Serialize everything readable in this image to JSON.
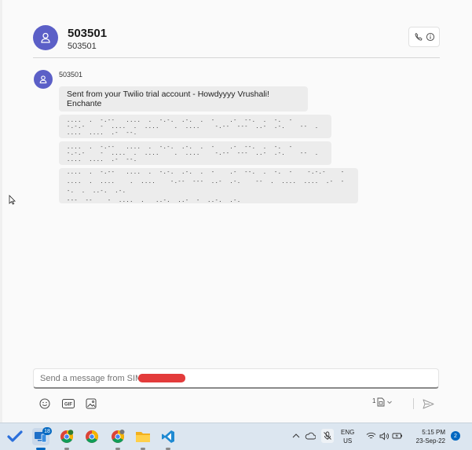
{
  "header": {
    "title": "503501",
    "subtitle": "503501"
  },
  "messages": {
    "sender": "503501",
    "items": [
      "Sent from your Twilio trial account - Howdyyyy Vrushali! Enchante",
      "....  .  -.--   ....  .  -.-.  .-.  .  -    .-  --.  .  -.  -    -.-.-    -  ....  .  ....    .  ....    -.--  ---  ..-  .-.    --  .  ....  ....  .-  --.",
      "....  .  -.--   ....  .  -.-.  .-.  .  -    .-  --.  .  -.  -    -.-.-    -  ....  .  ....    .  ....    -.--  ---  ..-  .-.    --  .  ....  ....  .-  --.",
      "....  .  -.--   ....  .  -.-.  .-.  .  -    .-  --.  .  -.  -    -.-.-    -  ....  .  ....    .  ....    -.--  ---  ..-  .-.    --  .  ....  ....  .-  --.  .  ..-.  .-.\n---  --    -  ....  .   ..-.  ..-  -  ..-.  .-."
    ]
  },
  "compose": {
    "placeholder": "Send a message from SIM",
    "sim_number": "1"
  },
  "taskbar": {
    "mail_badge": "18",
    "lang_line1": "ENG",
    "lang_line2": "US",
    "time": "5:15 PM",
    "date": "23-Sep-22",
    "notifications": "2"
  },
  "colors": {
    "avatar": "#5b5fc7",
    "bubble": "#ececec",
    "accent": "#0067c0",
    "taskbar": "#dce6f0",
    "redaction": "#e33b3b"
  },
  "icons": {
    "header_actions": [
      "phone-icon",
      "info-icon"
    ],
    "compose_tools": [
      "emoji-icon",
      "gif-icon",
      "image-icon"
    ],
    "send": "send-icon",
    "taskbar_apps": [
      "todo-icon",
      "phone-link-icon",
      "chrome-profile-icon",
      "chrome-icon",
      "chrome-canary-icon",
      "file-explorer-icon",
      "vscode-icon"
    ],
    "tray": [
      "chevron-up-icon",
      "cloud-icon",
      "mic-off-icon",
      "wifi-icon",
      "volume-icon",
      "battery-icon"
    ]
  }
}
